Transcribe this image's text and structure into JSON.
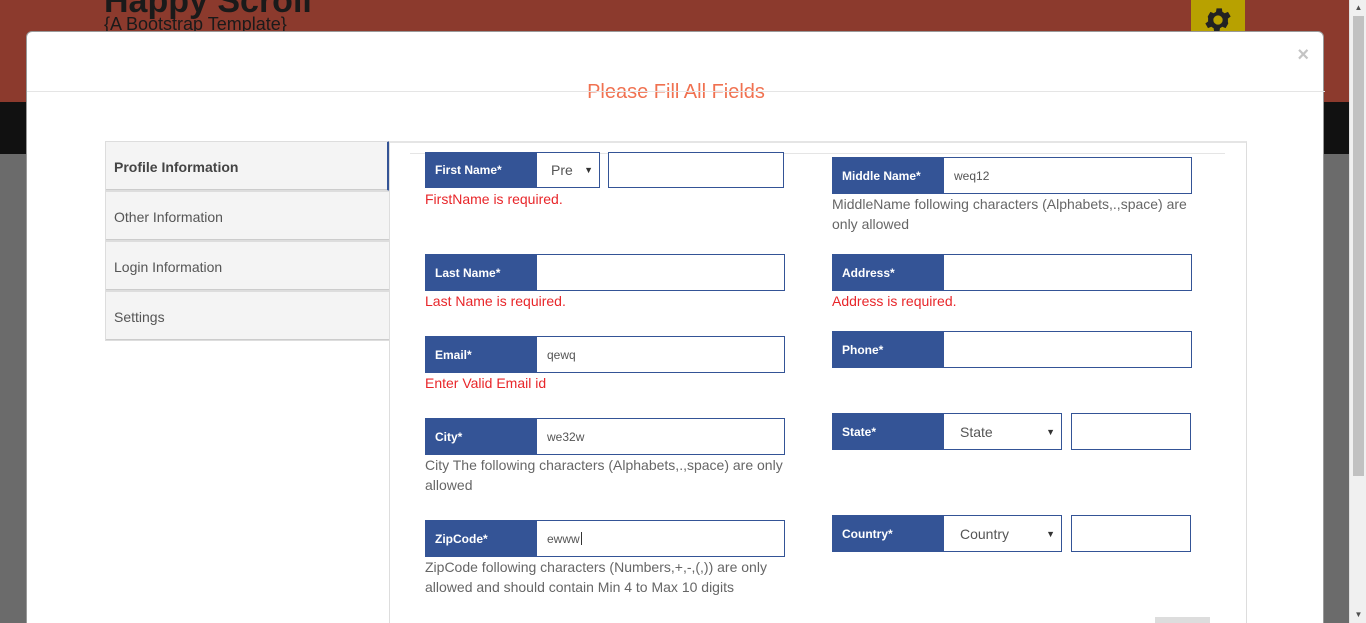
{
  "background": {
    "brand": "Happy Scroll",
    "tagline": "{A Bootstrap Template}"
  },
  "modal": {
    "title": "Please Fill All Fields",
    "close": "×"
  },
  "tabs": [
    {
      "label": "Profile Information",
      "active": true
    },
    {
      "label": "Other Information"
    },
    {
      "label": "Login Information"
    },
    {
      "label": "Settings"
    }
  ],
  "form": {
    "first_name": {
      "label": "First Name*",
      "prefix": "Pre",
      "value": "",
      "error": "FirstName is required."
    },
    "middle_name": {
      "label": "Middle Name*",
      "value": "weq12",
      "hint": "MiddleName following characters (Alphabets,.,space) are only allowed"
    },
    "last_name": {
      "label": "Last Name*",
      "value": "",
      "error": "Last Name is required."
    },
    "address": {
      "label": "Address*",
      "value": "",
      "error": "Address is required."
    },
    "email": {
      "label": "Email*",
      "value": "qewq",
      "error": "Enter Valid Email id"
    },
    "phone": {
      "label": "Phone*",
      "value": ""
    },
    "city": {
      "label": "City*",
      "value": "we32w",
      "hint": "City The following characters (Alphabets,.,space) are only allowed"
    },
    "state": {
      "label": "State*",
      "select": "State"
    },
    "zipcode": {
      "label": "ZipCode*",
      "value": "ewww",
      "hint": "ZipCode following characters (Numbers,+,-,(,)) are only allowed and should contain Min 4 to Max 10 digits"
    },
    "country": {
      "label": "Country*",
      "select": "Country"
    }
  },
  "colors": {
    "label_bg": "#345496",
    "title": "#f07150",
    "error": "#e8262a"
  }
}
